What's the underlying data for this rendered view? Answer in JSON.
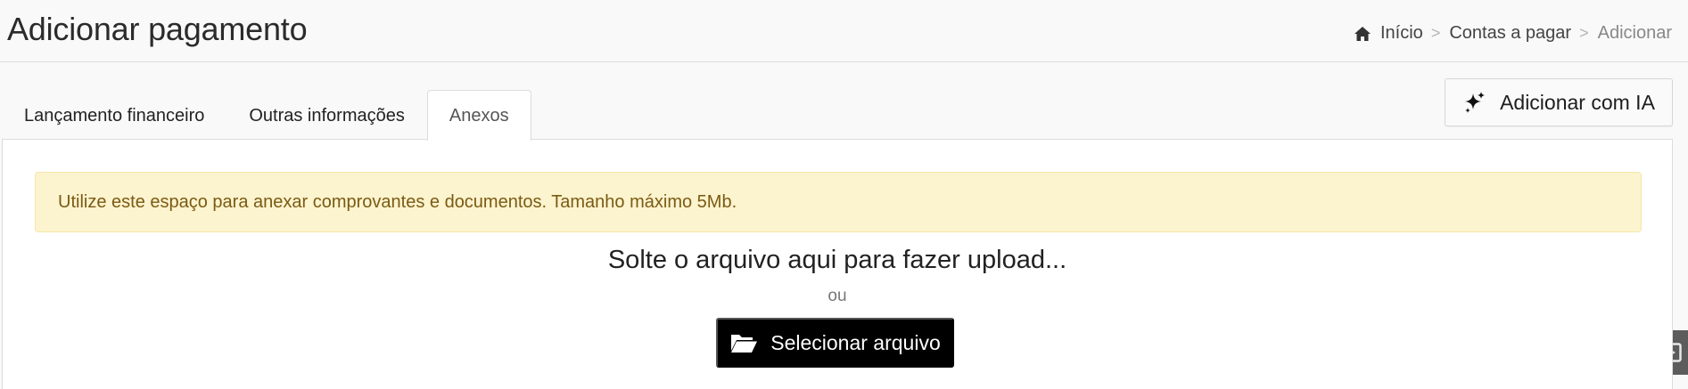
{
  "header": {
    "title": "Adicionar pagamento",
    "breadcrumb": [
      {
        "label": "Início",
        "icon": "home-icon"
      },
      {
        "label": "Contas a pagar"
      },
      {
        "label": "Adicionar"
      }
    ],
    "separator": ">"
  },
  "tabs": [
    {
      "label": "Lançamento financeiro",
      "active": false
    },
    {
      "label": "Outras informações",
      "active": false
    },
    {
      "label": "Anexos",
      "active": true
    }
  ],
  "ai_button": {
    "label": "Adicionar com IA",
    "icon": "sparkle-icon"
  },
  "upload": {
    "alert": "Utilize este espaço para anexar comprovantes e documentos. Tamanho máximo 5Mb.",
    "drop_text": "Solte o arquivo aqui para fazer upload...",
    "or_text": "ou",
    "select_button": {
      "label": "Selecionar arquivo",
      "icon": "folder-open-icon"
    }
  },
  "floating_widget": {
    "icon": "play-box-icon"
  },
  "colors": {
    "alert_bg": "#fcf3cf",
    "alert_text": "#7a5b12",
    "primary_button": "#000000",
    "header_bg": "#f9f9f9"
  }
}
